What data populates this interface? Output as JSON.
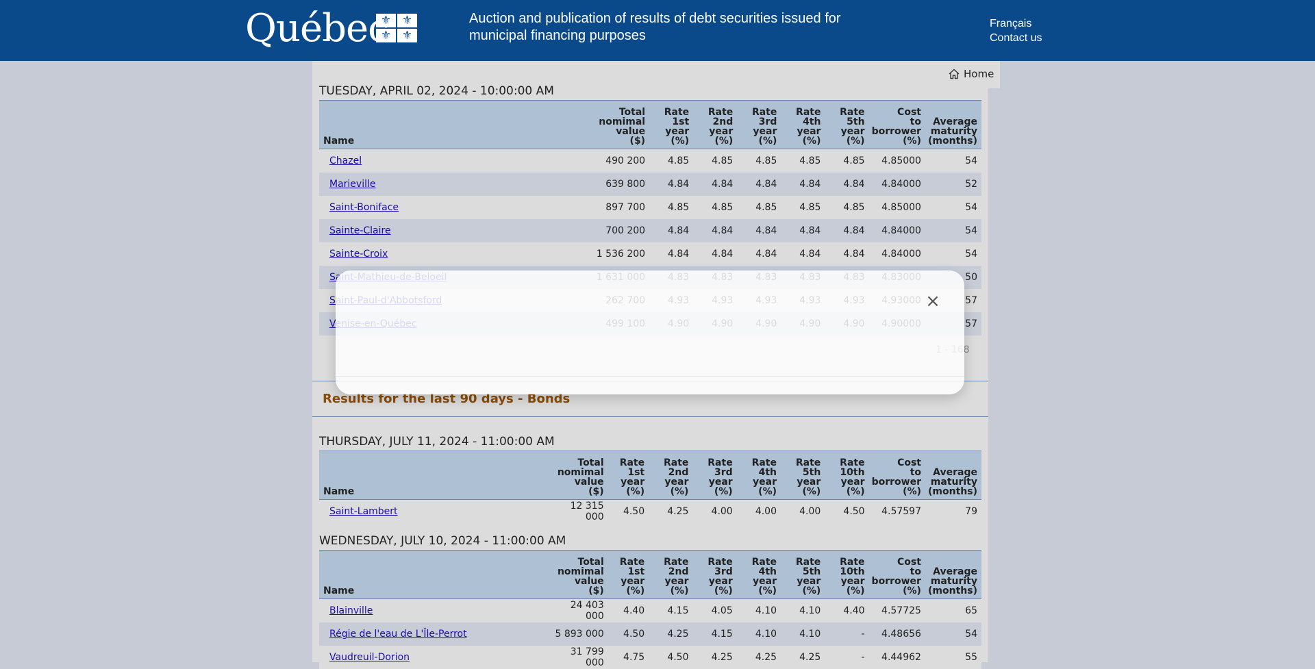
{
  "header": {
    "logo_text": "Québec",
    "flag_glyph": "⚜",
    "title": "Auction and publication of results of debt securities issued for municipal financing purposes",
    "lang_link": "Français",
    "contact_link": "Contact us",
    "bg_color": "#0a4a8b"
  },
  "nav": {
    "home_label": "Home",
    "home_icon": "home-icon"
  },
  "notes_section": {
    "date": "TUESDAY, APRIL 02, 2024 - 10:00:00 AM",
    "columns": [
      "Name",
      "Total nomimal value ($)",
      "Rate 1st year (%)",
      "Rate 2nd year (%)",
      "Rate 3rd year (%)",
      "Rate 4th year (%)",
      "Rate 5th year (%)",
      "Cost to borrower (%)",
      "Average maturity (months)"
    ],
    "rows": [
      {
        "name": "Chazel",
        "total": "490 200",
        "r1": "4.85",
        "r2": "4.85",
        "r3": "4.85",
        "r4": "4.85",
        "r5": "4.85",
        "cost": "4.85000",
        "maturity": "54"
      },
      {
        "name": "Marieville",
        "total": "639 800",
        "r1": "4.84",
        "r2": "4.84",
        "r3": "4.84",
        "r4": "4.84",
        "r5": "4.84",
        "cost": "4.84000",
        "maturity": "52"
      },
      {
        "name": "Saint-Boniface",
        "total": "897 700",
        "r1": "4.85",
        "r2": "4.85",
        "r3": "4.85",
        "r4": "4.85",
        "r5": "4.85",
        "cost": "4.85000",
        "maturity": "54"
      },
      {
        "name": "Sainte-Claire",
        "total": "700 200",
        "r1": "4.84",
        "r2": "4.84",
        "r3": "4.84",
        "r4": "4.84",
        "r5": "4.84",
        "cost": "4.84000",
        "maturity": "54"
      },
      {
        "name": "Sainte-Croix",
        "total": "1 536 200",
        "r1": "4.84",
        "r2": "4.84",
        "r3": "4.84",
        "r4": "4.84",
        "r5": "4.84",
        "cost": "4.84000",
        "maturity": "54"
      },
      {
        "name": "Saint-Mathieu-de-Beloeil",
        "total": "1 631 000",
        "r1": "4.83",
        "r2": "4.83",
        "r3": "4.83",
        "r4": "4.83",
        "r5": "4.83",
        "cost": "4.83000",
        "maturity": "50"
      },
      {
        "name": "Saint-Paul-d'Abbotsford",
        "total": "262 700",
        "r1": "4.93",
        "r2": "4.93",
        "r3": "4.93",
        "r4": "4.93",
        "r5": "4.93",
        "cost": "4.93000",
        "maturity": "57"
      },
      {
        "name": "Venise-en-Québec",
        "total": "499 100",
        "r1": "4.90",
        "r2": "4.90",
        "r3": "4.90",
        "r4": "4.90",
        "r5": "4.90",
        "cost": "4.90000",
        "maturity": "57"
      }
    ],
    "pager": "1 - 168"
  },
  "bonds_section": {
    "title": "Results for the last 90 days - Bonds",
    "columns": [
      "Name",
      "Total nomimal value ($)",
      "Rate 1st year (%)",
      "Rate 2nd year (%)",
      "Rate 3rd year (%)",
      "Rate 4th year (%)",
      "Rate 5th year (%)",
      "Rate 10th year (%)",
      "Cost to borrower (%)",
      "Average maturity (months)"
    ],
    "auctions": [
      {
        "date": "THURSDAY, JULY 11, 2024 - 11:00:00 AM",
        "rows": [
          {
            "name": "Saint-Lambert",
            "total": "12 315 000",
            "r1": "4.50",
            "r2": "4.25",
            "r3": "4.00",
            "r4": "4.00",
            "r5": "4.00",
            "r10": "4.50",
            "cost": "4.57597",
            "maturity": "79"
          }
        ]
      },
      {
        "date": "WEDNESDAY, JULY 10, 2024 - 11:00:00 AM",
        "rows": [
          {
            "name": "Blainville",
            "total": "24 403 000",
            "r1": "4.40",
            "r2": "4.15",
            "r3": "4.05",
            "r4": "4.10",
            "r5": "4.10",
            "r10": "4.40",
            "cost": "4.57725",
            "maturity": "65"
          },
          {
            "name": "Régie de l'eau de L'Île-Perrot",
            "total": "5 893 000",
            "r1": "4.50",
            "r2": "4.25",
            "r3": "4.15",
            "r4": "4.10",
            "r5": "4.10",
            "r10": "-",
            "cost": "4.48656",
            "maturity": "54"
          },
          {
            "name": "Vaudreuil-Dorion",
            "total": "31 799 000",
            "r1": "4.75",
            "r2": "4.50",
            "r3": "4.25",
            "r4": "4.25",
            "r5": "4.25",
            "r10": "-",
            "cost": "4.44962",
            "maturity": "55"
          }
        ]
      }
    ]
  },
  "modal": {
    "close_glyph": "×",
    "close_icon": "close-icon"
  }
}
